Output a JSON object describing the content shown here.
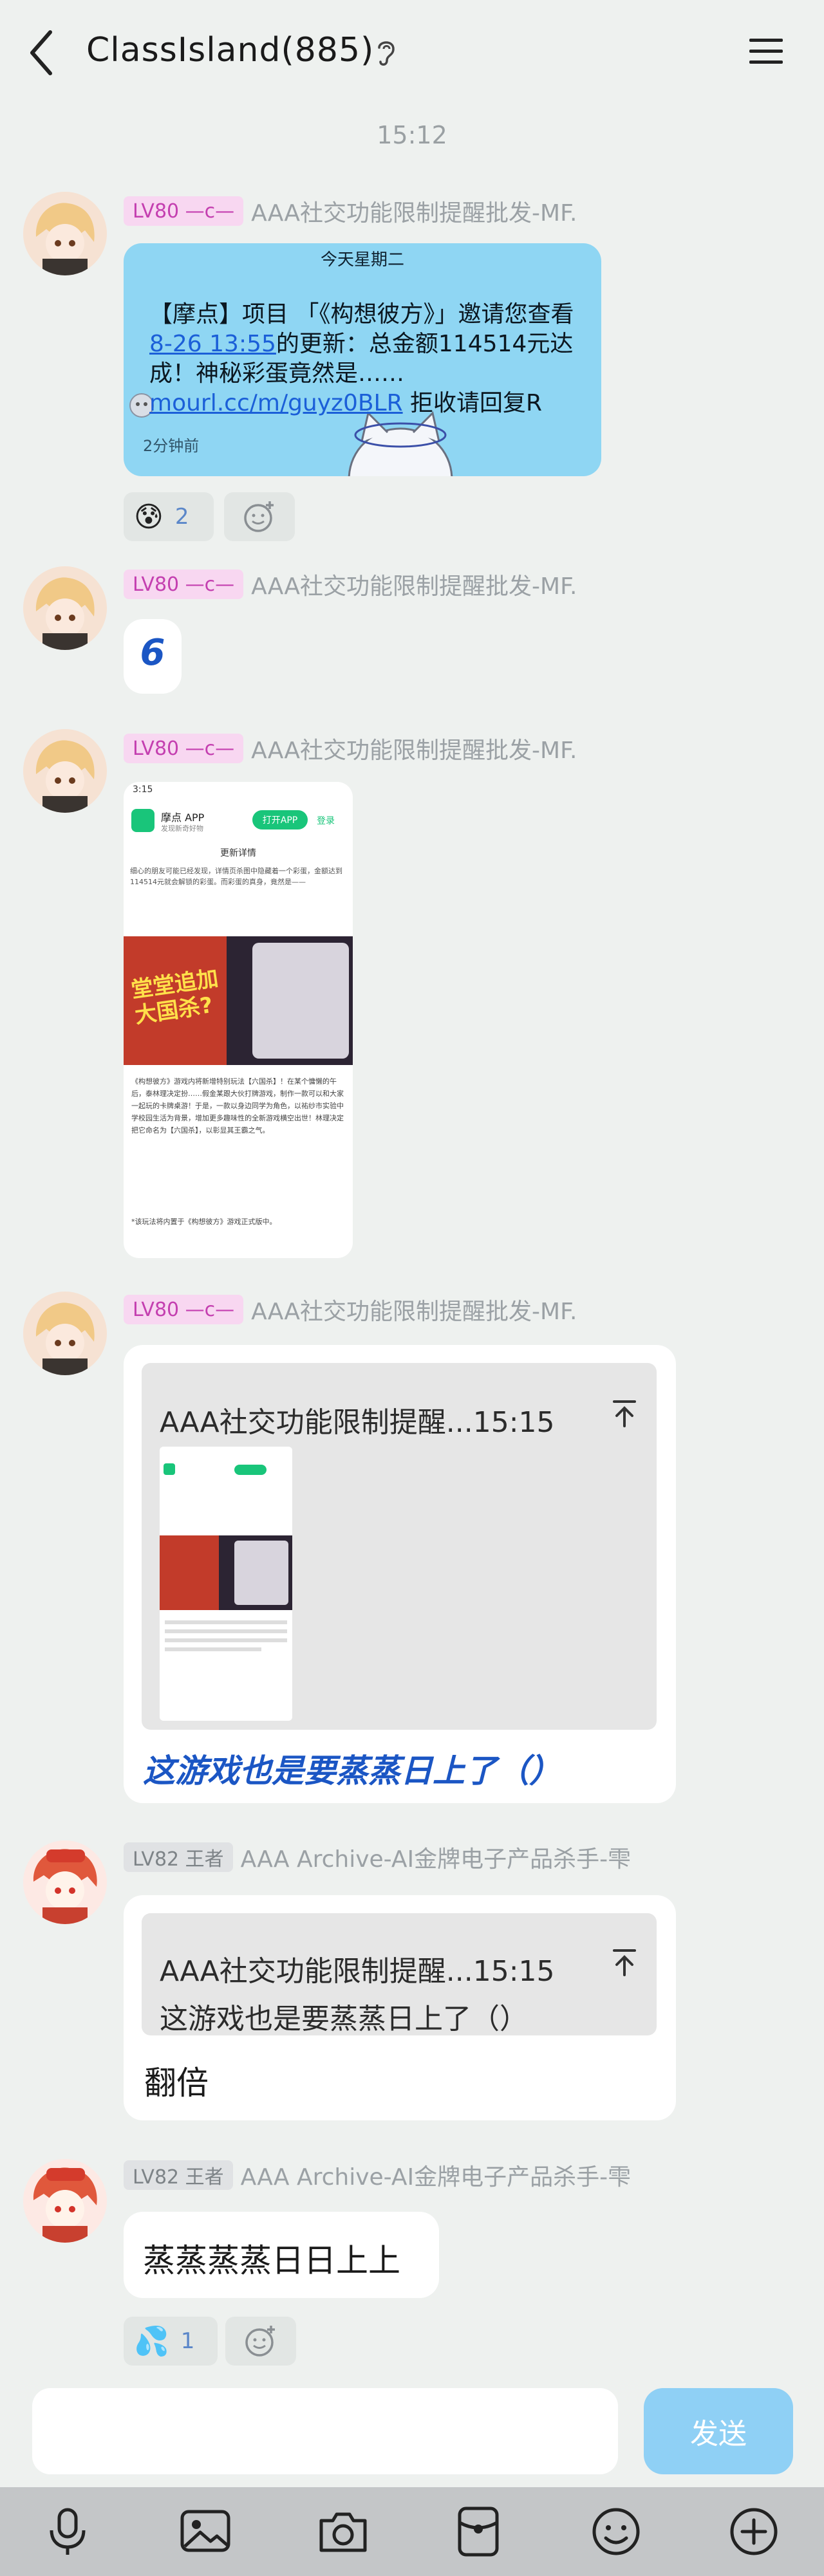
{
  "header": {
    "title": "ClassIsland(885)",
    "back_icon": "chevron-left-icon",
    "ear_icon": "ear-icon",
    "menu_icon": "menu-icon"
  },
  "time_divider": "15:12",
  "messages": [
    {
      "level": "LV80 —c—",
      "sender": "AAA社交功能限制提醒批发-MF.",
      "card": {
        "day": "今天星期二",
        "text_before": "【摩点】项目 「《构想彼方》」邀请您查看",
        "link_date": "8-26 13:55",
        "text_mid": "的更新：总金额114514元达成！神秘彩蛋竟然是…… ",
        "link_url": "mourl.cc/m/guyz0BLR",
        "text_after": " 拒收请回复R",
        "ago": "2分钟前"
      },
      "reaction": {
        "emoji": "😰",
        "count": "2"
      }
    },
    {
      "level": "LV80 —c—",
      "sender": "AAA社交功能限制提醒批发-MF.",
      "text": "6"
    },
    {
      "level": "LV80 —c—",
      "sender": "AAA社交功能限制提醒批发-MF.",
      "image": {
        "status_time": "3:15",
        "app_name": "摩点 APP",
        "app_sub": "发现新奇好物",
        "open_app": "打开APP",
        "login": "登录",
        "section": "更新详情",
        "body1": "细心的朋友可能已经发现，详情页杀图中隐藏着一个彩蛋，金额达到114514元就会解锁的彩蛋。而彩蛋的真身，竟然是——",
        "poster_title": "堂堂追加\n大国杀?",
        "body2": "《构想彼方》游戏内将新增特别玩法【六国杀】！在某个慵懒的午后，泰林理决定扮……假金某跟大伙打牌游戏，制作一款可以和大家一起玩的卡牌桌游！于是，一款以身边同学为角色，以祐纱市实验中学校园生活为背景，增加更多趣味性的全新游戏横空出世！林理决定把它命名为【六国杀】，以彰显其王霸之气。",
        "body3": "*该玩法将内置于《构想彼方》游戏正式版中。"
      }
    },
    {
      "level": "LV80 —c—",
      "sender": "AAA社交功能限制提醒批发-MF.",
      "quote_head": "AAA社交功能限制提醒...15:15",
      "text": "这游戏也是要蒸蒸日上了（）"
    },
    {
      "level": "LV82 王者",
      "sender": "AAA Archive-AI金牌电子产品杀手-雫",
      "quote_head": "AAA社交功能限制提醒...15:15",
      "quote_text": "这游戏也是要蒸蒸日上了（）",
      "text": "翻倍"
    },
    {
      "level": "LV82 王者",
      "sender": "AAA Archive-AI金牌电子产品杀手-雫",
      "text": "蒸蒸蒸蒸日日上上",
      "reaction": {
        "emoji": "💦",
        "count": "1"
      }
    }
  ],
  "input": {
    "placeholder": "",
    "send_label": "发送"
  },
  "toolbar_icons": [
    "microphone-icon",
    "image-icon",
    "camera-icon",
    "red-packet-icon",
    "emoji-icon",
    "plus-icon"
  ],
  "colors": {
    "accent_blue": "#1b5fd8",
    "card_blue": "#8fd6f3",
    "send_blue": "#8fd0f5",
    "level_pink": "#c43fb0"
  }
}
